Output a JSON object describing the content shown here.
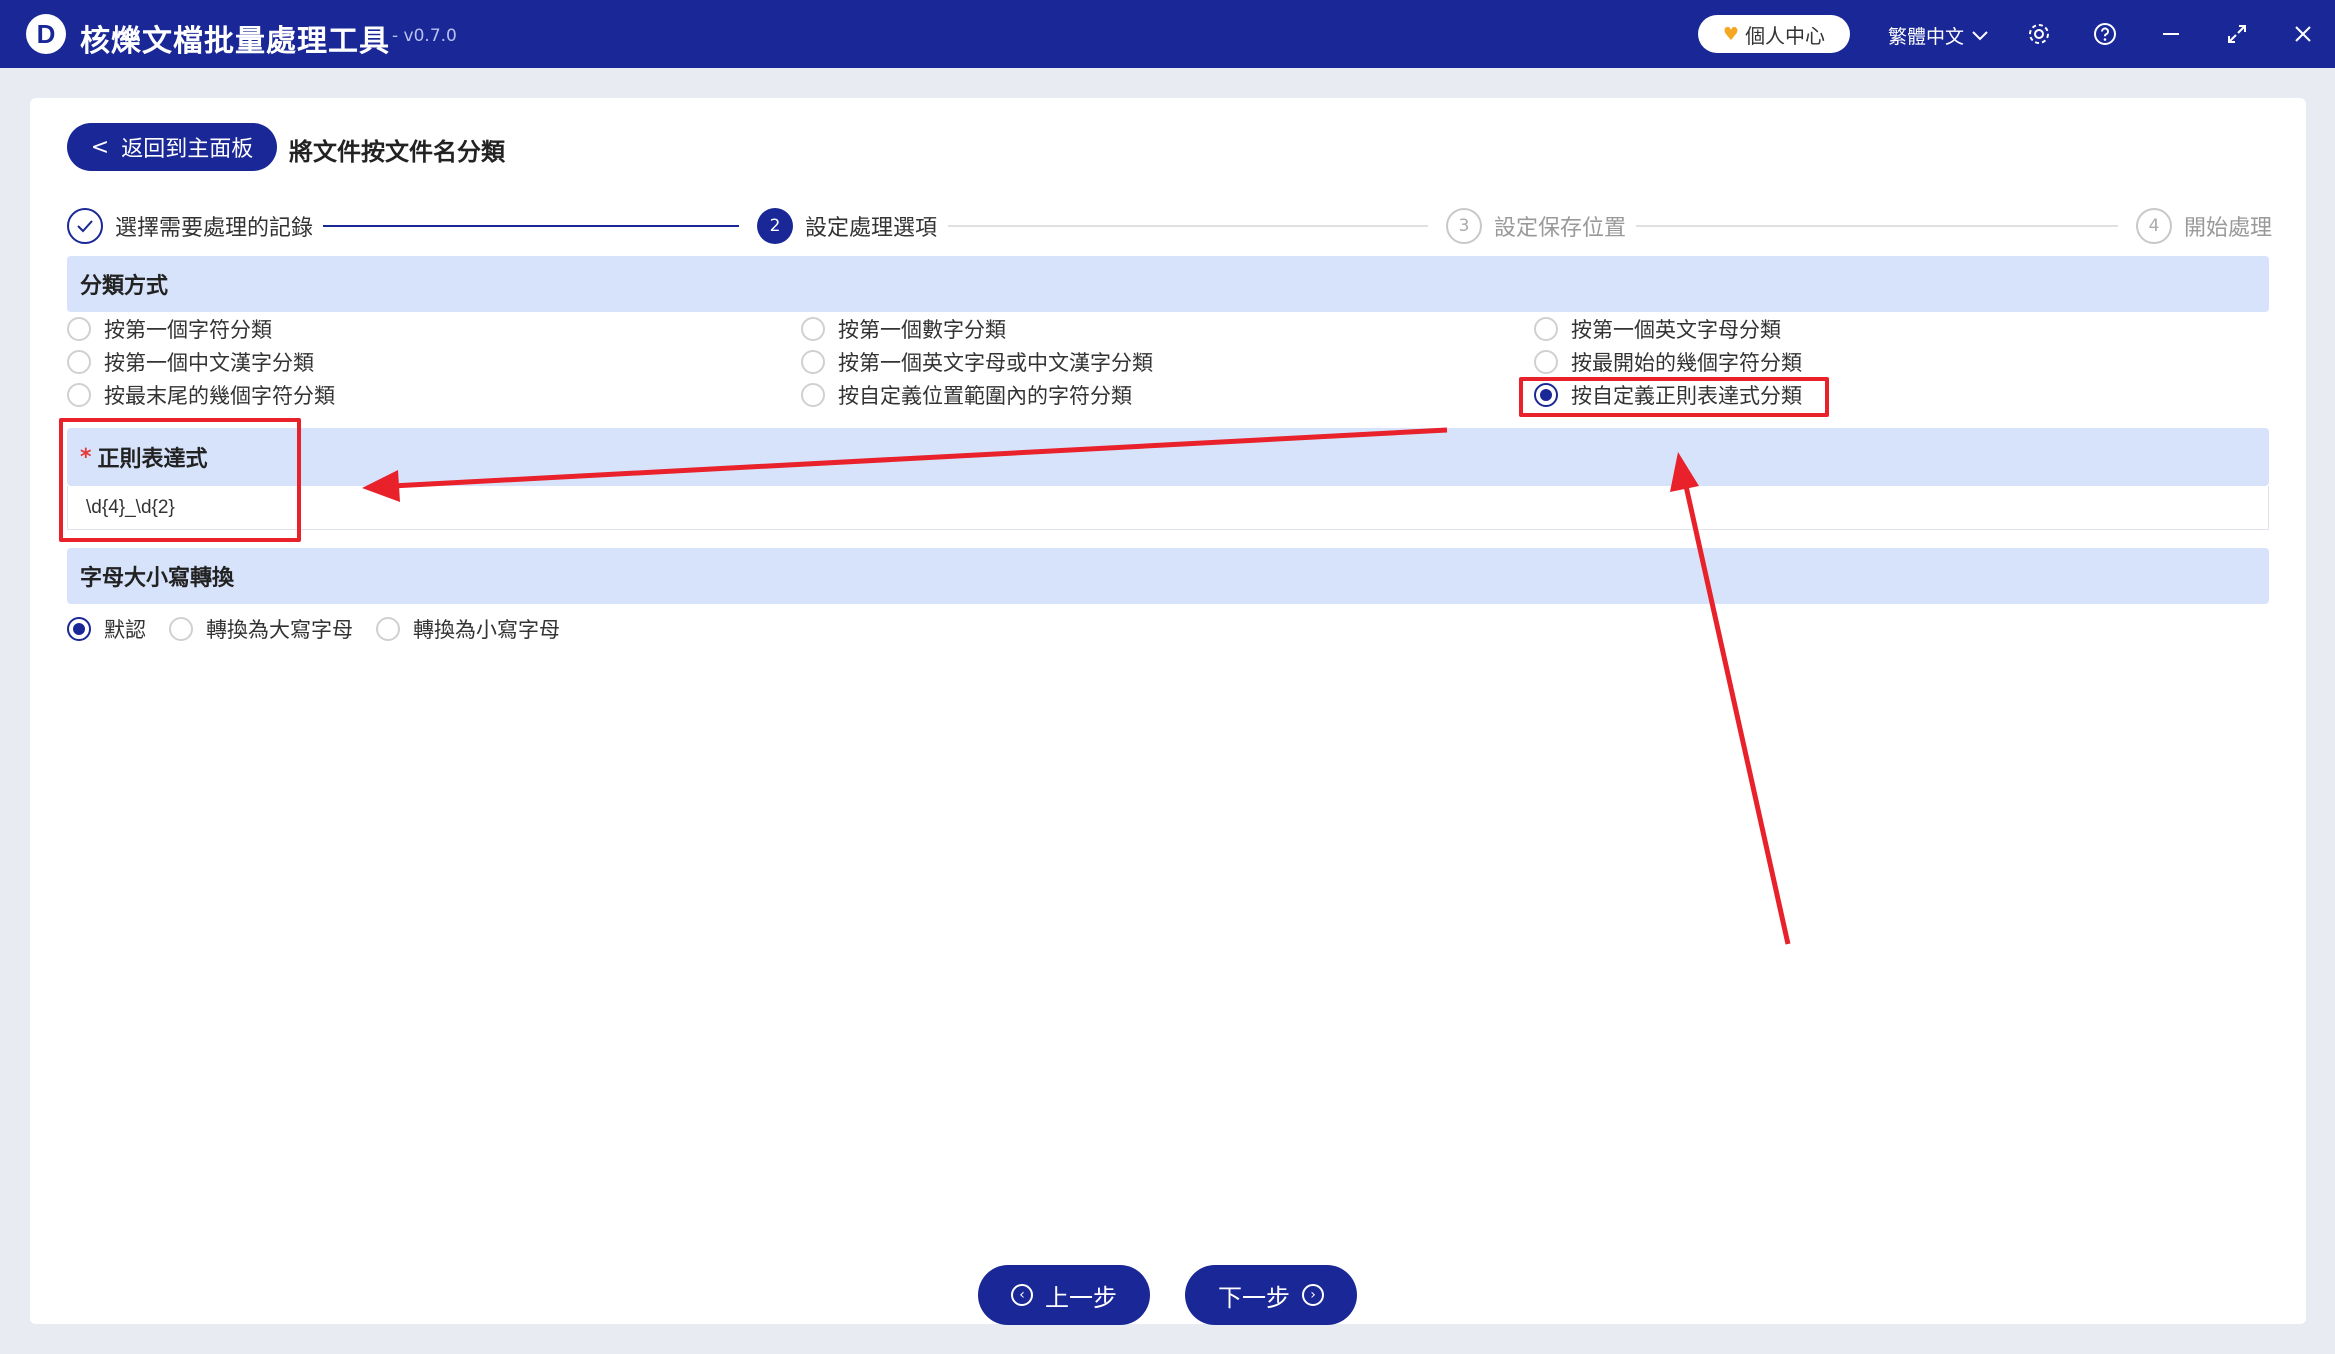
{
  "app": {
    "logo_letter": "D",
    "title": "核爍文檔批量處理工具",
    "version": "- v0.7.0",
    "user_center": "個人中心",
    "language": "繁體中文"
  },
  "header": {
    "back_label": "返回到主面板",
    "page_title": "將文件按文件名分類"
  },
  "steps": [
    {
      "number": "1",
      "label": "選擇需要處理的記錄",
      "state": "done"
    },
    {
      "number": "2",
      "label": "設定處理選項",
      "state": "active"
    },
    {
      "number": "3",
      "label": "設定保存位置",
      "state": "pending"
    },
    {
      "number": "4",
      "label": "開始處理",
      "state": "pending"
    }
  ],
  "classification": {
    "title": "分類方式",
    "options": [
      {
        "label": "按第一個字符分類",
        "checked": false
      },
      {
        "label": "按第一個數字分類",
        "checked": false
      },
      {
        "label": "按第一個英文字母分類",
        "checked": false
      },
      {
        "label": "按第一個中文漢字分類",
        "checked": false
      },
      {
        "label": "按第一個英文字母或中文漢字分類",
        "checked": false
      },
      {
        "label": "按最開始的幾個字符分類",
        "checked": false
      },
      {
        "label": "按最末尾的幾個字符分類",
        "checked": false
      },
      {
        "label": "按自定義位置範圍內的字符分類",
        "checked": false
      },
      {
        "label": "按自定義正則表達式分類",
        "checked": true
      }
    ]
  },
  "regex": {
    "required_mark": "*",
    "title": "正則表達式",
    "value": "\\d{4}_\\d{2}"
  },
  "case": {
    "title": "字母大小寫轉換",
    "options": [
      {
        "label": "默認",
        "checked": true
      },
      {
        "label": "轉換為大寫字母",
        "checked": false
      },
      {
        "label": "轉換為小寫字母",
        "checked": false
      }
    ]
  },
  "footer": {
    "prev_label": "上一步",
    "next_label": "下一步"
  },
  "colors": {
    "primary": "#1a2796",
    "section_bg": "#d7e3fb",
    "annotation": "#e8212b"
  }
}
